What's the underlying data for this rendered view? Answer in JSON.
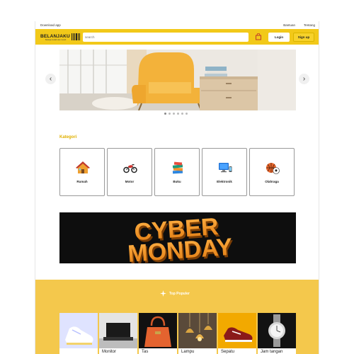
{
  "topbar": {
    "download": "Download app",
    "links": [
      "Bantuan",
      "Tentang"
    ]
  },
  "header": {
    "logo": "BELANJAKU",
    "logo_tagline": "Belanja mudah dan murah",
    "search_placeholder": "search",
    "login_label": "Login",
    "signup_label": "Sign up"
  },
  "carousel": {
    "dots": 6,
    "active_dot": 0
  },
  "kategori": {
    "title": "Kategori",
    "items": [
      {
        "label": "Rumah",
        "icon": "house-icon"
      },
      {
        "label": "Motor",
        "icon": "motorcycle-icon"
      },
      {
        "label": "Buku",
        "icon": "books-icon"
      },
      {
        "label": "Elektronik",
        "icon": "computer-icon"
      },
      {
        "label": "Olahraga",
        "icon": "sports-balls-icon"
      }
    ]
  },
  "banner": {
    "line1": "CYBER",
    "line2": "MONDAY"
  },
  "popular": {
    "title": "Top Populer",
    "items": [
      {
        "name": ""
      },
      {
        "name": "Monitor"
      },
      {
        "name": "Tas"
      },
      {
        "name": "Lampu"
      },
      {
        "name": "Sepatu"
      },
      {
        "name": "Jam tangan"
      }
    ]
  },
  "colors": {
    "brand": "#f2c919",
    "kategori_title": "#e0b000",
    "popular_bg": "#f4c84c"
  }
}
